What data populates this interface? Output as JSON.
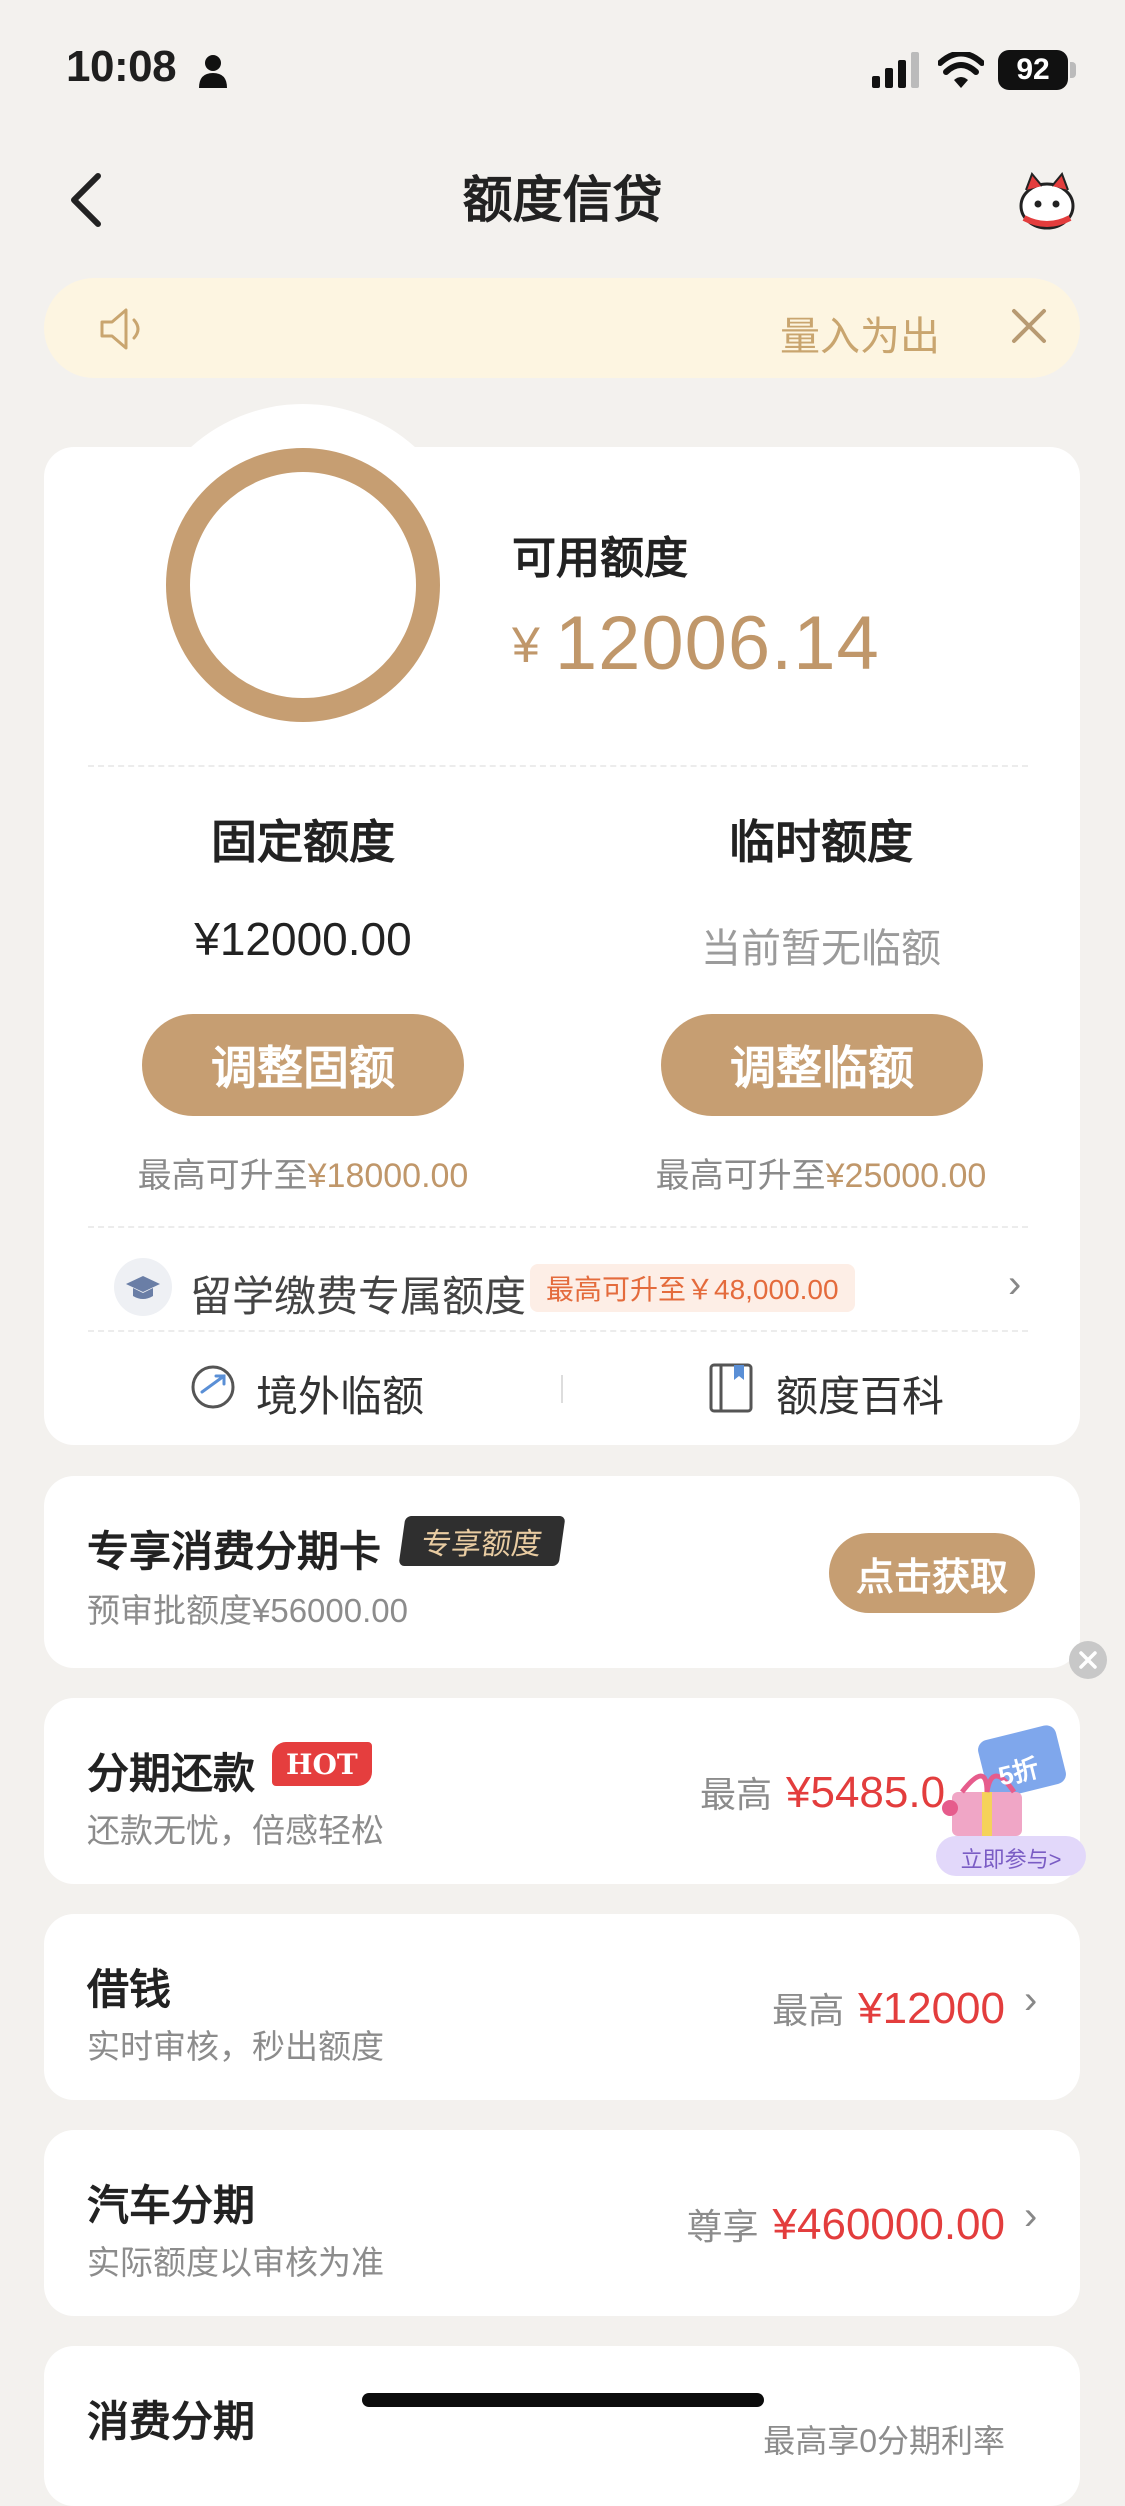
{
  "status_bar": {
    "time": "10:08",
    "battery": "92"
  },
  "header": {
    "title": "额度信贷"
  },
  "notice": {
    "text": "量入为出"
  },
  "credit": {
    "available_label": "可用额度",
    "currency_symbol": "¥",
    "available_amount": "12006.14",
    "fixed": {
      "title": "固定额度",
      "value": "¥12000.00",
      "button": "调整固额",
      "max_prefix": "最高可升至",
      "max_amount": "¥18000.00"
    },
    "temporary": {
      "title": "临时额度",
      "value": "当前暂无临额",
      "button": "调整临额",
      "max_prefix": "最高可升至",
      "max_amount": "¥25000.00"
    },
    "study": {
      "label": "留学缴费专属额度",
      "badge": "最高可升至￥48,000.00"
    },
    "links": {
      "overseas": "境外临额",
      "encyclopedia": "额度百科"
    }
  },
  "products": {
    "card_offer": {
      "title": "专享消费分期卡",
      "tag": "专享额度",
      "subtitle": "预审批额度¥56000.00",
      "button": "点击获取"
    },
    "installment": {
      "title": "分期还款",
      "tag": "HOT",
      "subtitle": "还款无忧，倍感轻松",
      "prefix": "最高",
      "amount": "¥5485.0"
    },
    "borrow": {
      "title": "借钱",
      "subtitle": "实时审核，秒出额度",
      "prefix": "最高",
      "amount": "¥12000"
    },
    "car": {
      "title": "汽车分期",
      "subtitle": "实际额度以审核为准",
      "prefix": "尊享",
      "amount": "¥460000.00"
    },
    "consumer": {
      "title": "消费分期",
      "right_text": "最高享0分期利率"
    }
  },
  "promo": {
    "discount": "5折",
    "cta": "立即参与>"
  },
  "colors": {
    "accent_gold": "#c69e72",
    "amount_red": "#e33d3d",
    "notice_bg": "#fdf5e1",
    "page_bg": "#f3f1ee"
  }
}
